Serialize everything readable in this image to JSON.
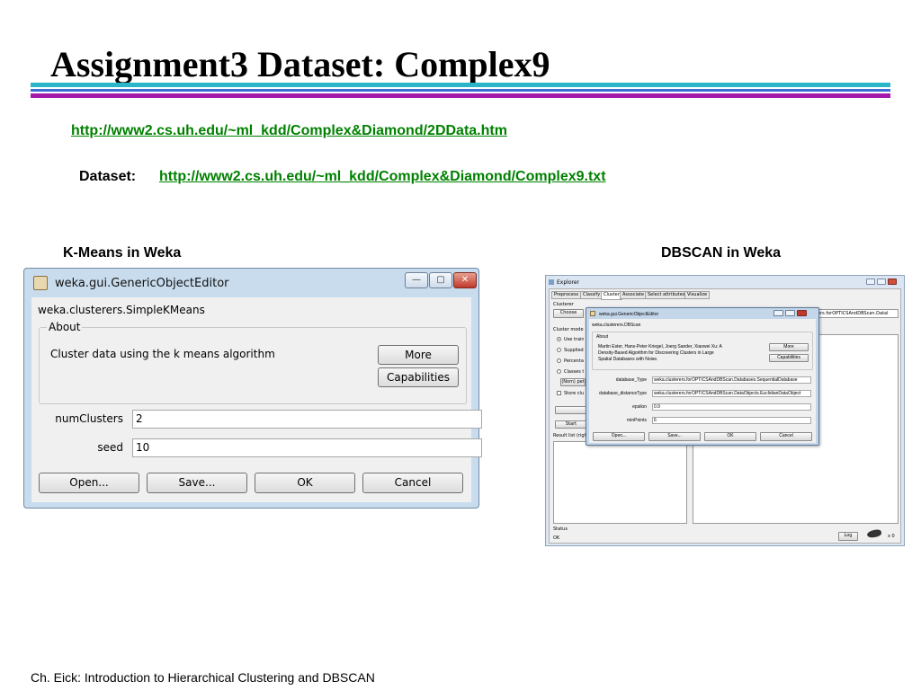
{
  "slide": {
    "title": "Assignment3 Dataset: Complex9",
    "link_page": "http://www2.cs.uh.edu/~ml_kdd/Complex&Diamond/2DData.htm",
    "dataset_label": "Dataset:",
    "link_dataset": "http://www2.cs.uh.edu/~ml_kdd/Complex&Diamond/Complex9.txt",
    "kmeans_caption": "K-Means in Weka",
    "dbscan_caption": "DBSCAN in Weka",
    "footer": "Ch. Eick: Introduction to Hierarchical Clustering and DBSCAN",
    "colors": {
      "link": "#008000",
      "rule_teal": "#2bb5c9",
      "rule_blue": "#3a6fd0",
      "rule_purple": "#a318a8"
    }
  },
  "kmeans_dialog": {
    "window_title": "weka.gui.GenericObjectEditor",
    "class_name": "weka.clusterers.SimpleKMeans",
    "about_title": "About",
    "about_text": "Cluster data using the k means algorithm",
    "more_label": "More",
    "capabilities_label": "Capabilities",
    "params": [
      {
        "label": "numClusters",
        "value": "2"
      },
      {
        "label": "seed",
        "value": "10"
      }
    ],
    "buttons": {
      "open": "Open...",
      "save": "Save...",
      "ok": "OK",
      "cancel": "Cancel"
    },
    "window_controls": {
      "minimize": "—",
      "maximize": "▢",
      "close": "✕"
    }
  },
  "explorer": {
    "window_title": "Explorer",
    "tabs": [
      "Preprocess",
      "Classify",
      "Cluster",
      "Associate",
      "Select attributes",
      "Visualize"
    ],
    "active_tab": "Cluster",
    "clusterer_label": "Clusterer",
    "choose_label": "Choose",
    "clusterer_value": "erers.forOPTICSAndDBScan.Datal",
    "cluster_mode_label": "Cluster mode",
    "modes": [
      "Use training set",
      "Supplied test set",
      "Percentage split",
      "Classes to clusters evaluation"
    ],
    "nom_label": "(Nom) pet",
    "store_label": "Store clusters for visualization",
    "start_label": "Start",
    "result_list_label": "Result list (right-click for options)",
    "status_label": "Status",
    "status_value": "OK",
    "log_label": "Log",
    "count": "x 0"
  },
  "dbscan_dialog": {
    "window_title": "weka.gui.GenericObjectEditor",
    "class_name": "weka.clusterers.DBScan",
    "about_title": "About",
    "about_text": "Martin Ester, Hans-Peter Kriegel, Joerg Sander, Xiaowei Xu: A Density-Based Algorithm for Discovering Clusters in Large Spatial Databases with Noise.",
    "more_label": "More",
    "capabilities_label": "Capabilities",
    "params": [
      {
        "label": "database_Type",
        "value": "weka.clusterers.forOPTICSAndDBScan.Databases.SequentialDatabase"
      },
      {
        "label": "database_distanceType",
        "value": "weka.clusterers.forOPTICSAndDBScan.DataObjects.EuclidianDataObject"
      },
      {
        "label": "epsilon",
        "value": "0.9"
      },
      {
        "label": "minPoints",
        "value": "6"
      }
    ],
    "buttons": {
      "open": "Open...",
      "save": "Save...",
      "ok": "OK",
      "cancel": "Cancel"
    }
  }
}
